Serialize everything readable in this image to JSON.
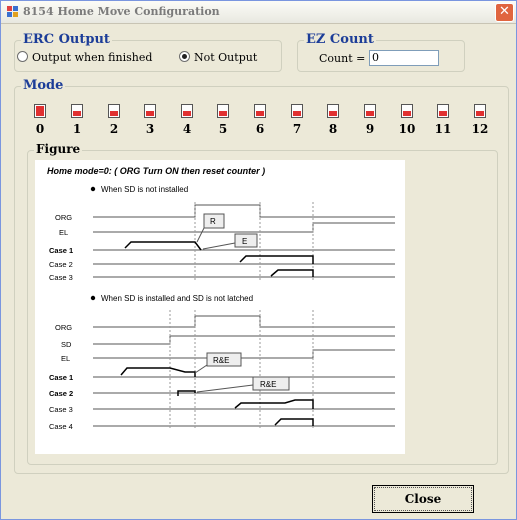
{
  "window": {
    "title": "8154 Home Move Configuration"
  },
  "erc_output": {
    "title": "ERC Output",
    "options": [
      "Output when finished",
      "Not Output"
    ],
    "selected": 1
  },
  "ez_count": {
    "title": "EZ Count",
    "count_label": "Count =",
    "count_value": "0"
  },
  "mode": {
    "title": "Mode",
    "numbers": [
      "0",
      "1",
      "2",
      "3",
      "4",
      "5",
      "6",
      "7",
      "8",
      "9",
      "10",
      "11",
      "12"
    ],
    "selected": 0
  },
  "figure": {
    "group_title": "Figure",
    "heading": "Home mode=0: ( ORG Turn ON then reset counter )",
    "section1": {
      "bullet": "When SD is not installed",
      "signals": [
        "ORG",
        "EL",
        "Case 1",
        "Case 2",
        "Case 3"
      ],
      "labels": [
        "R",
        "E"
      ]
    },
    "section2": {
      "bullet": "When SD is installed and SD is not latched",
      "signals": [
        "ORG",
        "SD",
        "EL",
        "Case 1",
        "Case 2",
        "Case 3",
        "Case 4"
      ],
      "labels": [
        "R&E",
        "R&E"
      ]
    }
  },
  "buttons": {
    "close": "Close"
  },
  "colors": {
    "group_title": "#1c3d98",
    "mode_indicator": "#e03030",
    "close_x": "#e0653f"
  }
}
